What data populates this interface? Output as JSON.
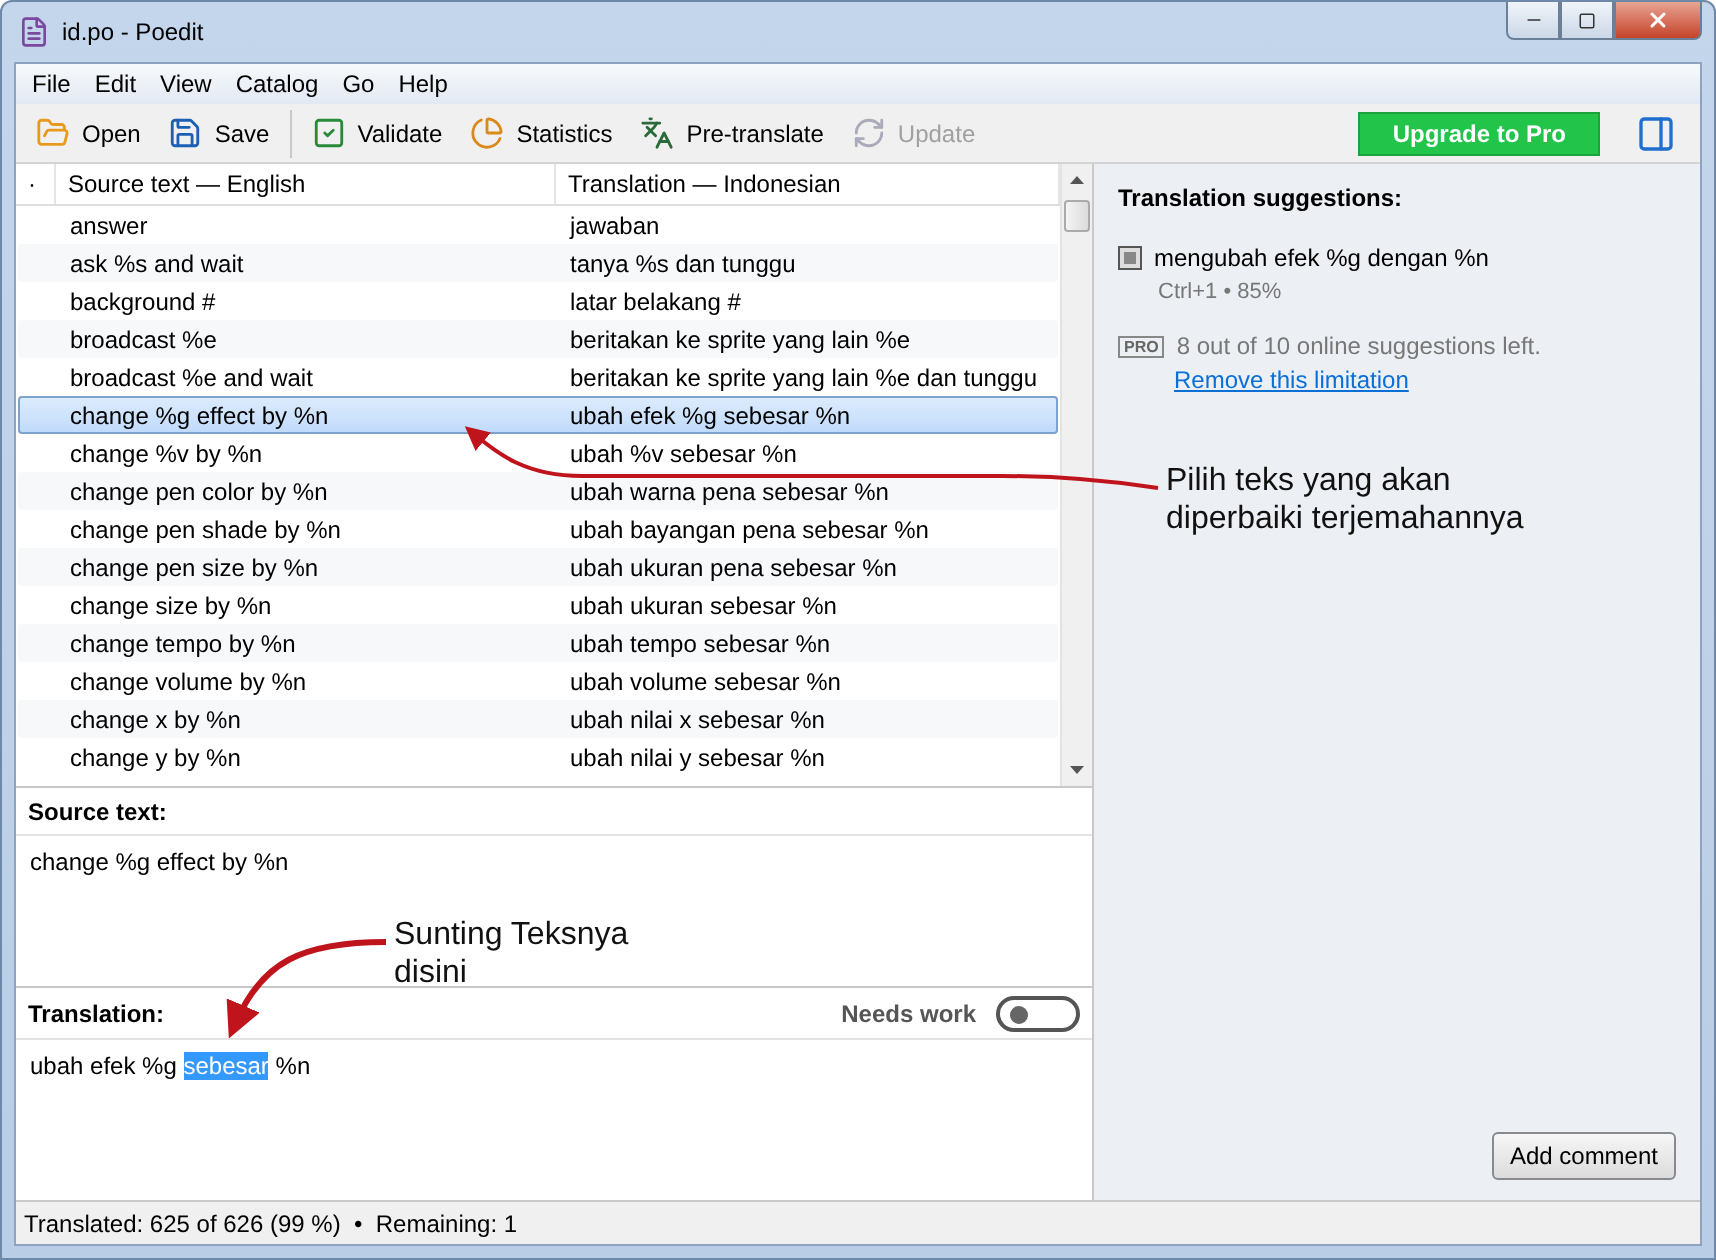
{
  "window": {
    "title": "id.po - Poedit"
  },
  "menu": [
    "File",
    "Edit",
    "View",
    "Catalog",
    "Go",
    "Help"
  ],
  "toolbar": [
    {
      "label": "Open",
      "kind": "open",
      "disabled": false
    },
    {
      "label": "Save",
      "kind": "save",
      "disabled": false
    },
    {
      "label": "Validate",
      "kind": "validate",
      "disabled": false
    },
    {
      "label": "Statistics",
      "kind": "statistics",
      "disabled": false
    },
    {
      "label": "Pre-translate",
      "kind": "pretranslate",
      "disabled": false
    },
    {
      "label": "Update",
      "kind": "update",
      "disabled": true
    }
  ],
  "upgrade_button": "Upgrade to Pro",
  "table": {
    "marker": "·",
    "columns": [
      "Source text — English",
      "Translation — Indonesian"
    ],
    "rows": [
      {
        "source": "answer",
        "translation": "jawaban",
        "selected": false
      },
      {
        "source": "ask %s and wait",
        "translation": "tanya %s dan tunggu",
        "selected": false
      },
      {
        "source": "background #",
        "translation": "latar belakang #",
        "selected": false
      },
      {
        "source": "broadcast %e",
        "translation": "beritakan ke sprite yang lain %e",
        "selected": false
      },
      {
        "source": "broadcast %e and wait",
        "translation": "beritakan ke sprite yang lain %e dan tunggu",
        "selected": false
      },
      {
        "source": "change %g effect by %n",
        "translation": "ubah efek %g sebesar %n",
        "selected": true
      },
      {
        "source": "change %v by %n",
        "translation": "ubah %v sebesar %n",
        "selected": false
      },
      {
        "source": "change pen color by %n",
        "translation": "ubah warna pena sebesar %n",
        "selected": false
      },
      {
        "source": "change pen shade by %n",
        "translation": "ubah bayangan pena sebesar %n",
        "selected": false
      },
      {
        "source": "change pen size by %n",
        "translation": "ubah ukuran pena sebesar %n",
        "selected": false
      },
      {
        "source": "change size by %n",
        "translation": "ubah ukuran sebesar %n",
        "selected": false
      },
      {
        "source": "change tempo by %n",
        "translation": "ubah tempo sebesar %n",
        "selected": false
      },
      {
        "source": "change volume by %n",
        "translation": "ubah volume sebesar %n",
        "selected": false
      },
      {
        "source": "change x by %n",
        "translation": "ubah nilai x sebesar %n",
        "selected": false
      },
      {
        "source": "change y by %n",
        "translation": "ubah nilai y sebesar %n",
        "selected": false
      }
    ]
  },
  "source_panel": {
    "label": "Source text:",
    "text": "change %g effect by %n"
  },
  "translation_panel": {
    "label": "Translation:",
    "needs_work_label": "Needs work",
    "needs_work_on": false,
    "parts": [
      {
        "text": "ubah efek %g ",
        "selected": false
      },
      {
        "text": "sebesar",
        "selected": true
      },
      {
        "text": " %n",
        "selected": false
      }
    ]
  },
  "suggestions": {
    "title": "Translation suggestions:",
    "items": [
      {
        "text": "mengubah efek %g dengan %n",
        "meta": "Ctrl+1 • 85%"
      }
    ],
    "pro_badge": "PRO",
    "pro_text": "8 out of 10 online suggestions left.",
    "pro_link": "Remove this limitation"
  },
  "add_comment": "Add comment",
  "annotations": [
    {
      "text": "Pilih teks yang akan diperbaiki terjemahannya",
      "kind": "list"
    },
    {
      "text": "Sunting Teksnya disini",
      "kind": "editor"
    }
  ],
  "status_bar": "Translated: 625 of 626 (99 %)  •  Remaining: 1"
}
